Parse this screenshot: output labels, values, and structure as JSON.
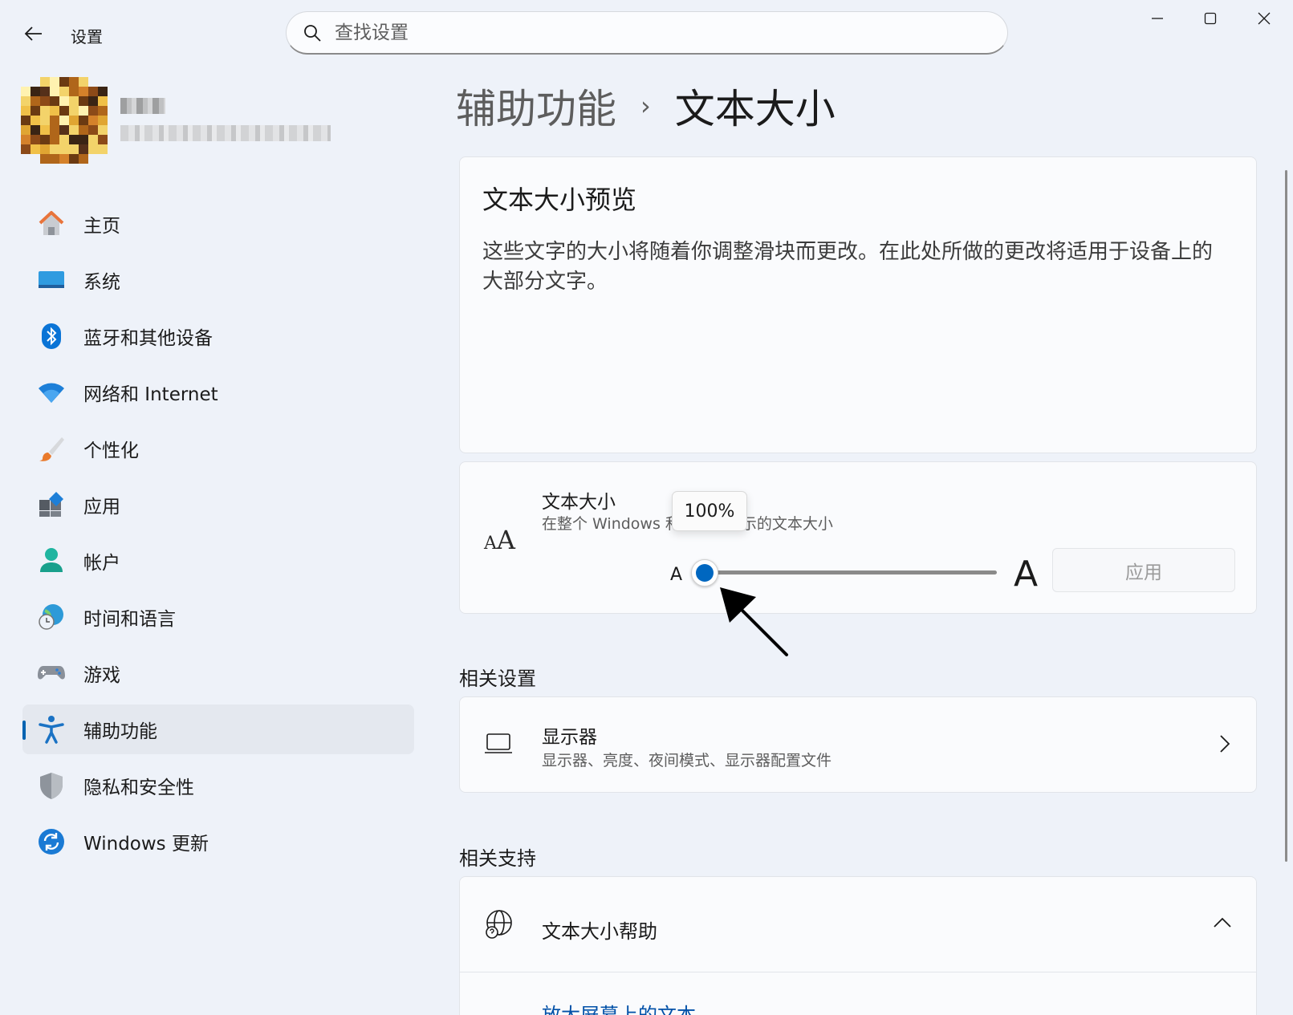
{
  "app": {
    "title": "设置",
    "search_placeholder": "查找设置"
  },
  "sidebar": {
    "items": [
      {
        "label": "主页"
      },
      {
        "label": "系统"
      },
      {
        "label": "蓝牙和其他设备"
      },
      {
        "label": "网络和 Internet"
      },
      {
        "label": "个性化"
      },
      {
        "label": "应用"
      },
      {
        "label": "帐户"
      },
      {
        "label": "时间和语言"
      },
      {
        "label": "游戏"
      },
      {
        "label": "辅助功能"
      },
      {
        "label": "隐私和安全性"
      },
      {
        "label": "Windows 更新"
      }
    ],
    "active_index": 9
  },
  "breadcrumb": {
    "parent": "辅助功能",
    "separator": "›",
    "current": "文本大小"
  },
  "preview": {
    "title": "文本大小预览",
    "text": "这些文字的大小将随着你调整滑块而更改。在此处所做的更改将适用于设备上的大部分文字。"
  },
  "text_size": {
    "title": "文本大小",
    "description": "在整个 Windows 和应用中显示的文本大小",
    "small_label": "A",
    "large_label": "A",
    "tooltip": "100%",
    "value_percent": 100,
    "min_percent": 100,
    "max_percent": 225,
    "apply_label": "应用",
    "icon_small_glyph": "A",
    "icon_large_glyph": "A"
  },
  "related_settings": {
    "heading": "相关设置",
    "items": [
      {
        "title": "显示器",
        "description": "显示器、亮度、夜间模式、显示器配置文件"
      }
    ]
  },
  "related_support": {
    "heading": "相关支持",
    "help_title": "文本大小帮助",
    "link": "放大屏幕上的文本"
  },
  "colors": {
    "accent": "#0067c0",
    "background": "#eef2f9",
    "card": "#fafbfd"
  }
}
